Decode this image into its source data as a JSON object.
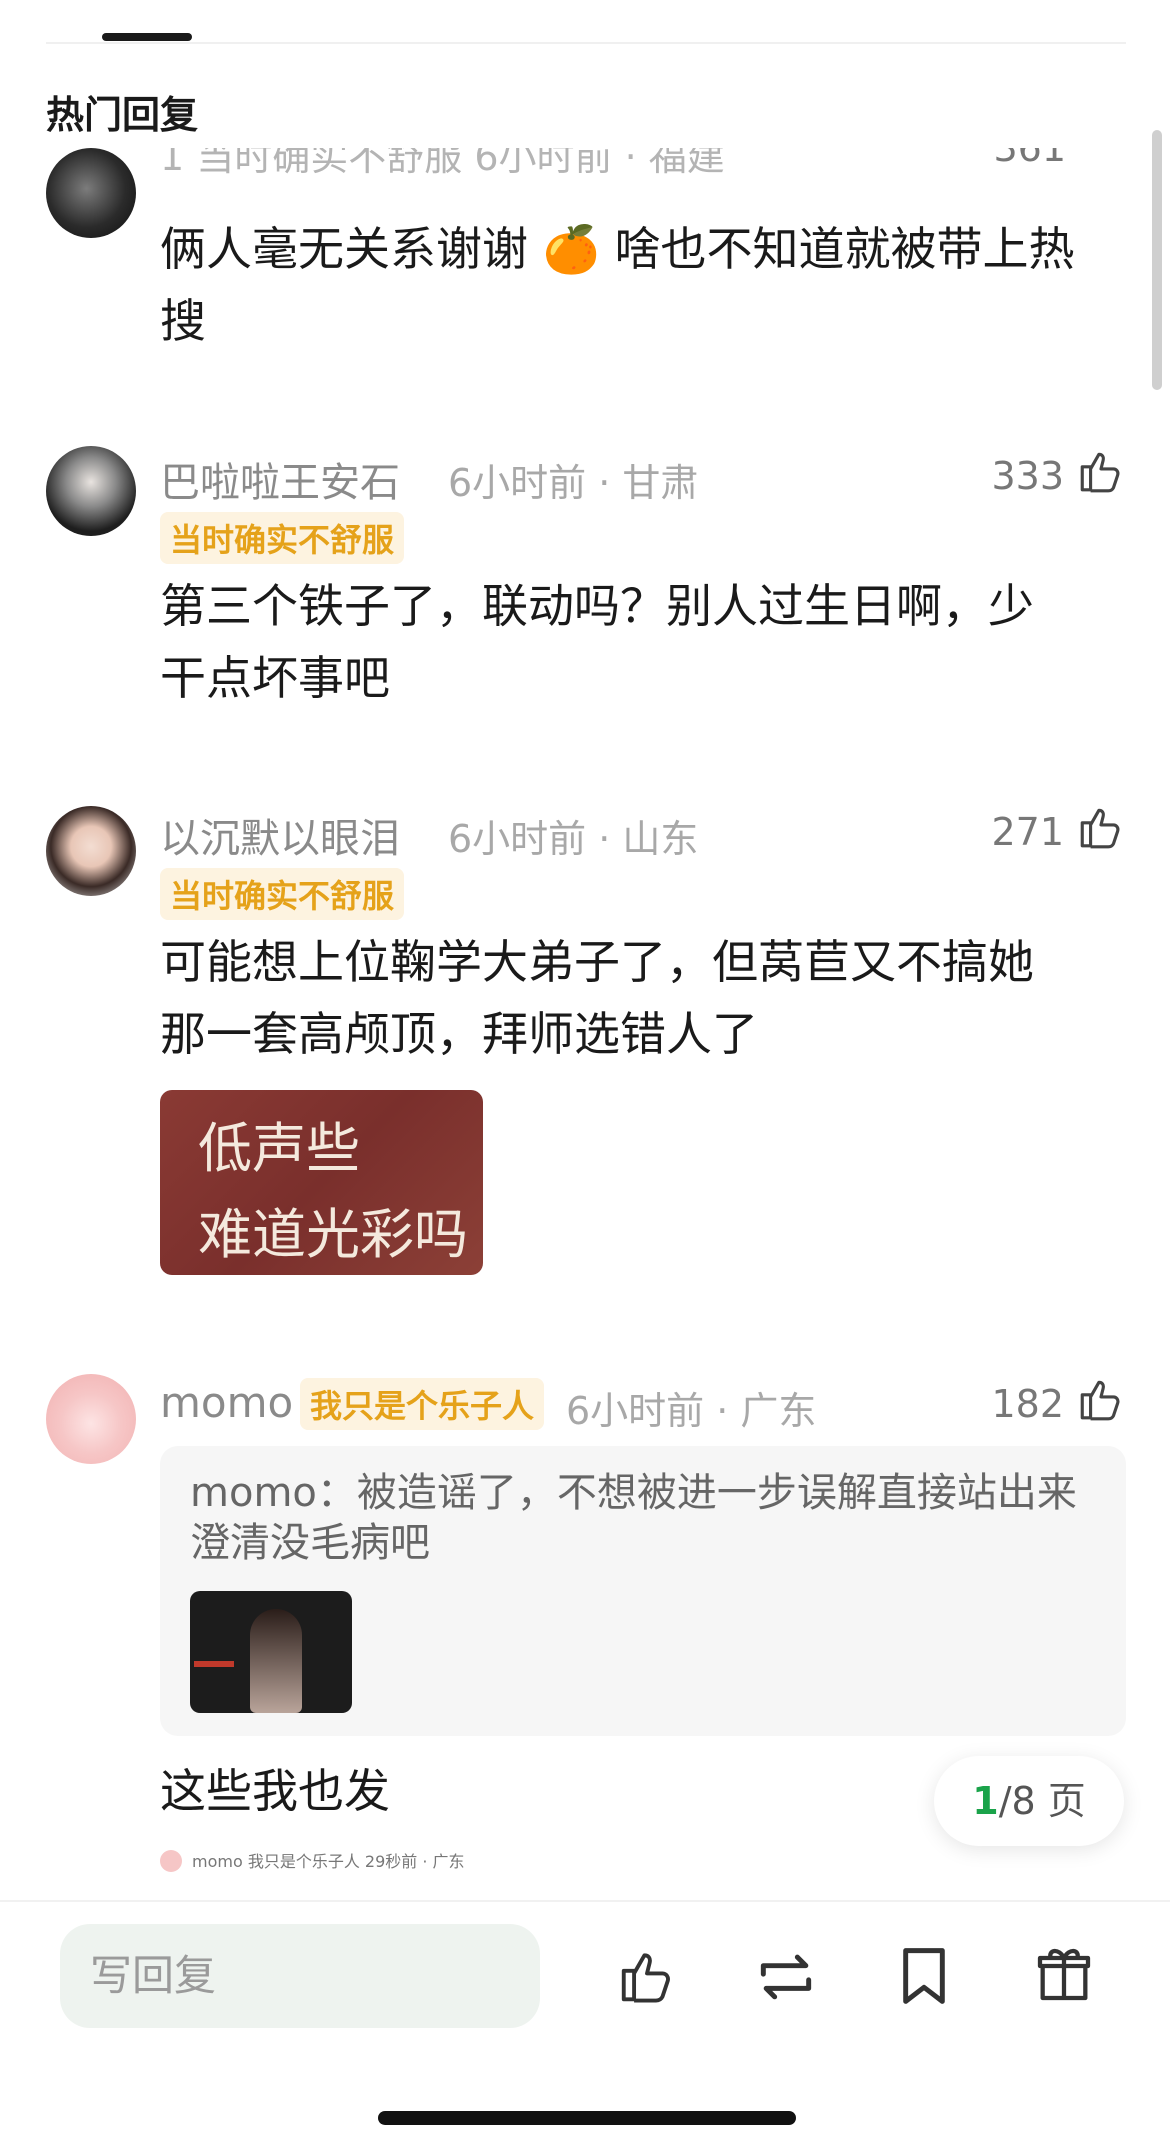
{
  "header": {
    "section_title": "热门回复"
  },
  "comments": [
    {
      "partial_header": "1  当时确实不舒服  6小时前 · 福建",
      "likes": "361",
      "text_line1": "俩人毫无关系谢谢 🍊 啥也不知道就被带上热",
      "text_line2": "搜"
    },
    {
      "username": "巴啦啦王安石",
      "meta": "6小时前 · 甘肃",
      "badge": "当时确实不舒服",
      "likes": "333",
      "text_line1": "第三个铁子了，联动吗？别人过生日啊，少",
      "text_line2": "干点坏事吧"
    },
    {
      "username": "以沉默以眼泪",
      "meta": "6小时前 · 山东",
      "badge": "当时确实不舒服",
      "likes": "271",
      "text_line1": "可能想上位鞠学大弟子了，但莴苣又不搞她",
      "text_line2": "那一套高颅顶，拜师选错人了",
      "sticker_line1": "低声些",
      "sticker_line2": "难道光彩吗"
    },
    {
      "username": "momo",
      "meta": "6小时前 · 广东",
      "badge": "我只是个乐子人",
      "likes": "182",
      "quote_line1": "momo：被造谣了，不想被进一步误解直接站出来",
      "quote_line2": "澄清没毛病吧",
      "text": "这些我也发",
      "ghost_preview": "momo  我只是个乐子人  29秒前 · 广东"
    }
  ],
  "pagination": {
    "current": "1",
    "rest": "/8 页"
  },
  "bottom_bar": {
    "reply_placeholder": "写回复"
  },
  "colors": {
    "badge_text": "#e5a21a",
    "badge_bg": "#fdf3e0",
    "page_current": "#1aa34a"
  }
}
